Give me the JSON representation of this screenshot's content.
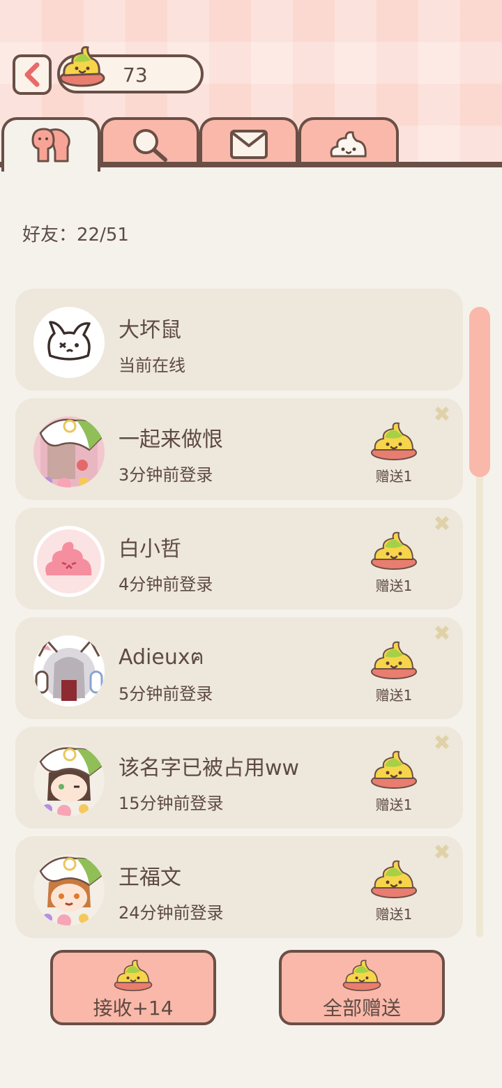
{
  "header": {
    "back_icon": "back-arrow-icon",
    "currency_icon": "poop-coin-icon",
    "currency_value": "73"
  },
  "tabs": [
    {
      "icon": "friends-icon",
      "active": true
    },
    {
      "icon": "search-icon",
      "active": false
    },
    {
      "icon": "mail-icon",
      "active": false
    },
    {
      "icon": "cloud-poop-icon",
      "active": false
    }
  ],
  "friend_count": "好友：22/51",
  "friends": [
    {
      "name": "大坏鼠",
      "status": "当前在线",
      "gift": null,
      "avatar": "bunny-sketch-avatar"
    },
    {
      "name": "一起来做恨",
      "status": "3分钟前登录",
      "gift": "赠送1",
      "avatar": "leaf-hat-avatar"
    },
    {
      "name": "白小哲",
      "status": "4分钟前登录",
      "gift": "赠送1",
      "avatar": "pink-poop-avatar"
    },
    {
      "name": "Adieuxฅ",
      "status": "5分钟前登录",
      "gift": "赠送1",
      "avatar": "headphone-girl-avatar"
    },
    {
      "name": "该名字已被占用ww",
      "status": "15分钟前登录",
      "gift": "赠送1",
      "avatar": "leaf-hat-girl-avatar"
    },
    {
      "name": "王福文",
      "status": "24分钟前登录",
      "gift": "赠送1",
      "avatar": "leaf-hat-boy-avatar"
    }
  ],
  "buttons": {
    "receive": "接收+14",
    "send_all": "全部赠送"
  },
  "colors": {
    "accent": "#f9b8a9",
    "outline": "#6a4f46",
    "card": "#eee7dc",
    "background": "#f5f2ec"
  }
}
